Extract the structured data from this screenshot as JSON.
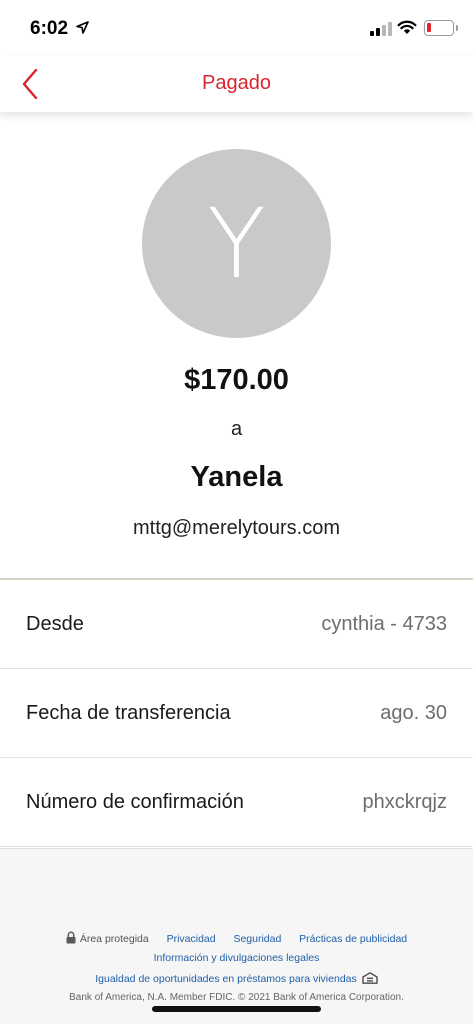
{
  "status_bar": {
    "time": "6:02"
  },
  "nav": {
    "title": "Pagado"
  },
  "payment": {
    "avatar_initial": "Y",
    "amount": "$170.00",
    "to_word": "a",
    "payee_name": "Yanela",
    "payee_email": "mttg@merelytours.com"
  },
  "details": [
    {
      "label": "Desde",
      "value": "cynthia - 4733"
    },
    {
      "label": "Fecha de transferencia",
      "value": "ago. 30"
    },
    {
      "label": "Número de confirmación",
      "value": "phxckrqjz"
    }
  ],
  "footer": {
    "secure_area": "Área protegida",
    "privacy": "Privacidad",
    "security": "Seguridad",
    "ad_practices": "Prácticas de publicidad",
    "legal": "Información y divulgaciones legales",
    "equal_housing": "Igualdad de oportunidades en préstamos para viviendas",
    "copyright": "Bank of America, N.A. Member FDIC. © 2021 Bank of America Corporation."
  },
  "colors": {
    "accent": "#d7262f",
    "link": "#1f5fa8",
    "avatar_bg": "#c9c9c9",
    "battery_low": "#e0262a"
  },
  "icons": [
    "location-arrow-icon",
    "cellular-signal-icon",
    "wifi-icon",
    "battery-icon",
    "back-chevron-icon",
    "lock-icon",
    "equal-housing-icon"
  ]
}
